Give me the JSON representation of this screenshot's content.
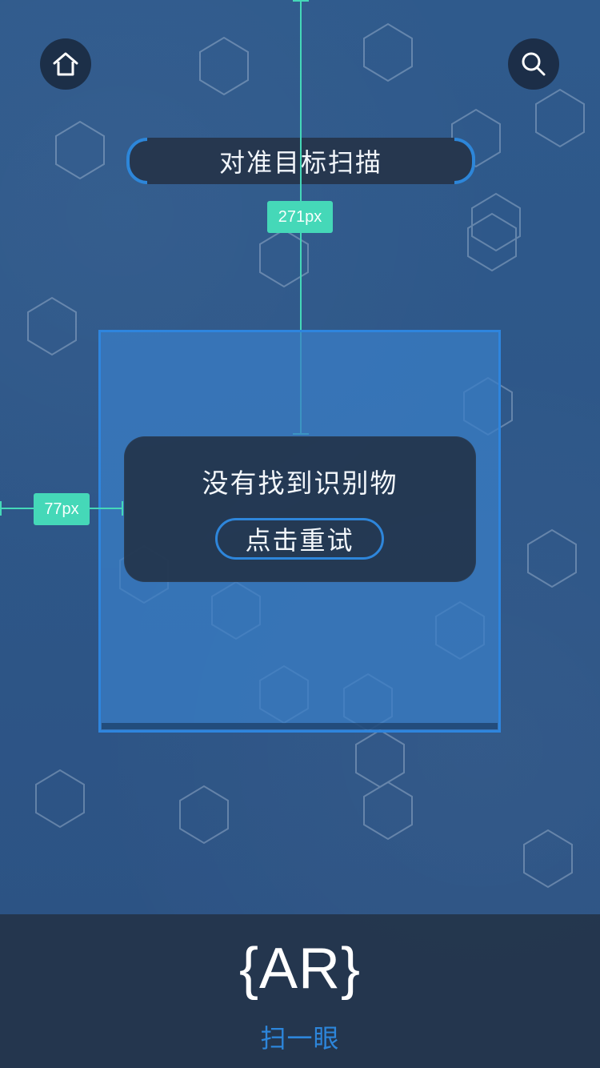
{
  "header": {
    "home_icon": "home-icon",
    "search_icon": "search-icon"
  },
  "scan_prompt": "对准目标扫描",
  "measurements": {
    "vertical_label": "271px",
    "horizontal_label": "77px"
  },
  "result_dialog": {
    "message": "没有找到识别物",
    "retry_label": "点击重试"
  },
  "bottom_bar": {
    "logo_text": "{AR}",
    "action_label": "扫一眼"
  },
  "colors": {
    "accent": "#2d86db",
    "guide": "#45d8b8",
    "background": "#2d5486",
    "panel": "#26374f"
  }
}
